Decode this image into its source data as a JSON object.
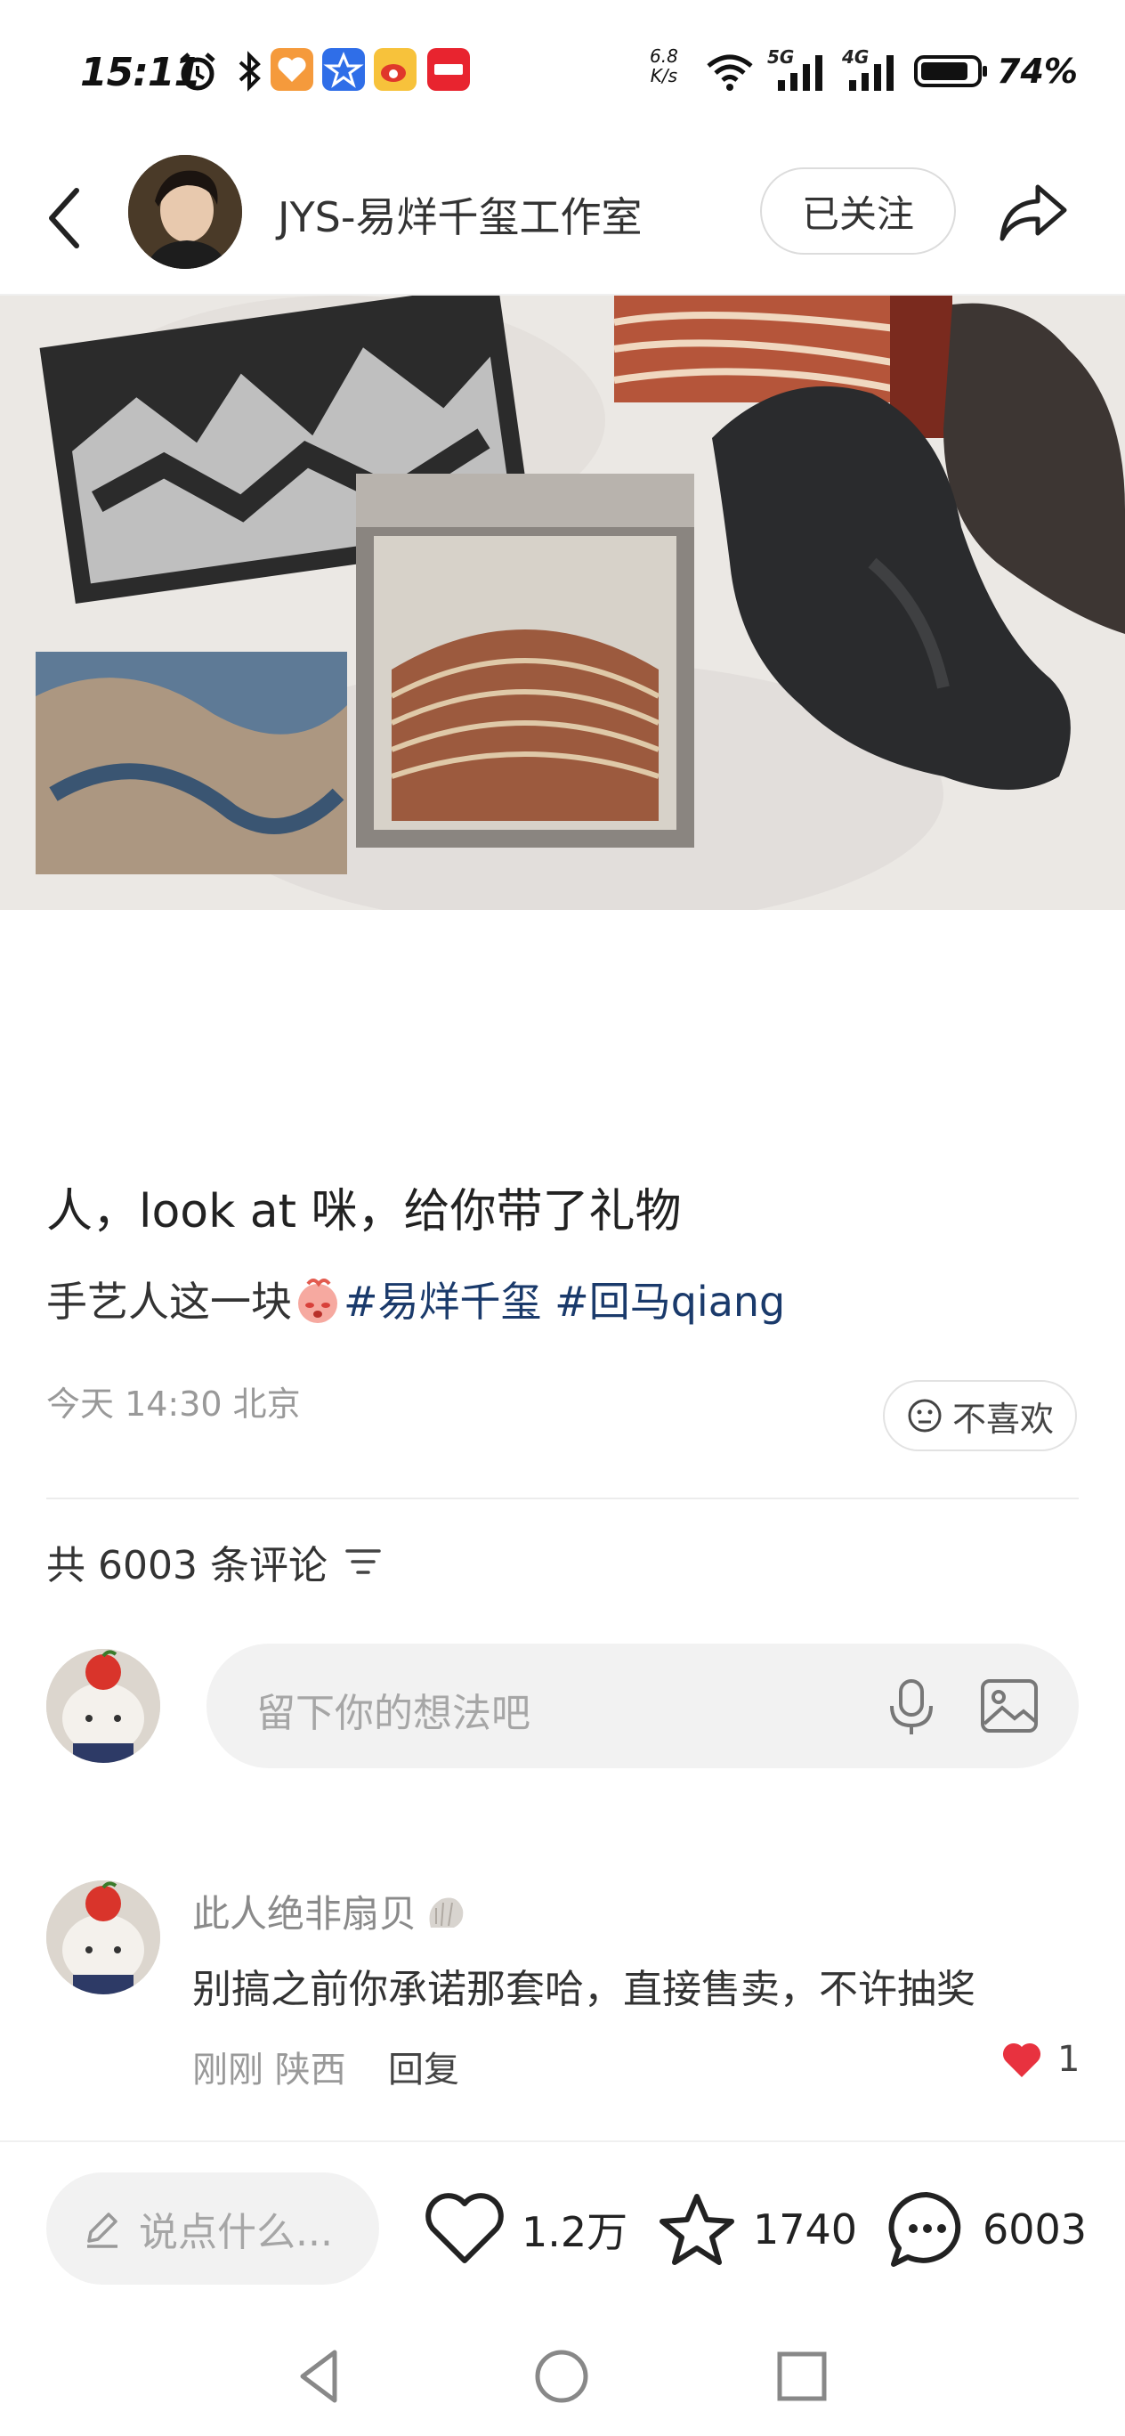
{
  "status_bar": {
    "time": "15:11",
    "net_speed_value": "6.8",
    "net_speed_unit": "K/s",
    "signal_1": "5G",
    "signal_2": "4G",
    "battery": "74%",
    "icons": [
      "alarm-icon",
      "bluetooth-icon",
      "app-heart-icon",
      "app-star-icon",
      "weibo-icon",
      "xiaohongshu-icon",
      "wifi-icon"
    ]
  },
  "header": {
    "author_name": "JYS-易烊千玺工作室",
    "follow_label": "已关注"
  },
  "post": {
    "title": "人，look at 咪，给你带了礼物",
    "body_text": "手艺人这一块",
    "tags": [
      "#易烊千玺",
      "#回马qiang"
    ],
    "meta": "今天 14:30 北京",
    "dislike_label": "不喜欢"
  },
  "comments": {
    "count_label": "共 6003 条评论",
    "input_placeholder": "留下你的想法吧",
    "items": [
      {
        "user": "此人绝非扇贝",
        "text": "别搞之前你承诺那套哈，直接售卖，不许抽奖",
        "time": "刚刚",
        "location": "陕西",
        "reply_label": "回复",
        "likes": "1"
      }
    ]
  },
  "bottom_bar": {
    "say_placeholder": "说点什么...",
    "likes": "1.2万",
    "favorites": "1740",
    "comments": "6003"
  },
  "colors": {
    "tag": "#1a3a6b",
    "like_heart": "#e8323f",
    "muted": "#999999"
  }
}
